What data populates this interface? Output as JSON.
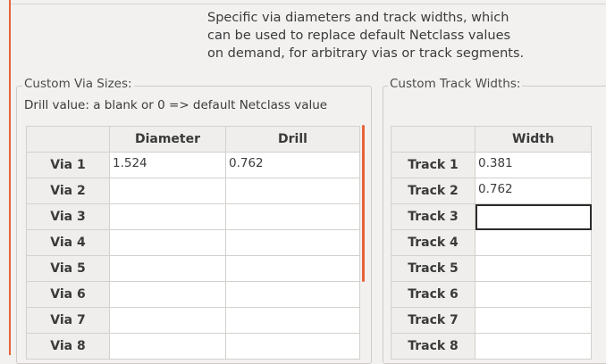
{
  "description": "Specific via diameters and track widths, which\ncan be used to replace default Netclass values\non demand, for arbitrary vias or track segments.",
  "via_panel": {
    "title": "Custom Via Sizes:",
    "hint": "Drill value: a blank or 0 => default Netclass value",
    "columns": [
      "",
      "Diameter",
      "Drill"
    ],
    "rows": [
      {
        "label": "Via 1",
        "diameter": "1.524",
        "drill": "0.762"
      },
      {
        "label": "Via 2",
        "diameter": "",
        "drill": ""
      },
      {
        "label": "Via 3",
        "diameter": "",
        "drill": ""
      },
      {
        "label": "Via 4",
        "diameter": "",
        "drill": ""
      },
      {
        "label": "Via 5",
        "diameter": "",
        "drill": ""
      },
      {
        "label": "Via 6",
        "diameter": "",
        "drill": ""
      },
      {
        "label": "Via 7",
        "diameter": "",
        "drill": ""
      },
      {
        "label": "Via 8",
        "diameter": "",
        "drill": ""
      }
    ]
  },
  "track_panel": {
    "title": "Custom Track Widths:",
    "columns": [
      "",
      "Width"
    ],
    "rows": [
      {
        "label": "Track 1",
        "width": "0.381"
      },
      {
        "label": "Track 2",
        "width": "0.762"
      },
      {
        "label": "Track 3",
        "width": ""
      },
      {
        "label": "Track 4",
        "width": ""
      },
      {
        "label": "Track 5",
        "width": ""
      },
      {
        "label": "Track 6",
        "width": ""
      },
      {
        "label": "Track 7",
        "width": ""
      },
      {
        "label": "Track 8",
        "width": ""
      }
    ]
  },
  "colors": {
    "accent": "#e8623a",
    "background": "#f2f1f0",
    "grid_header": "#efeeec"
  }
}
